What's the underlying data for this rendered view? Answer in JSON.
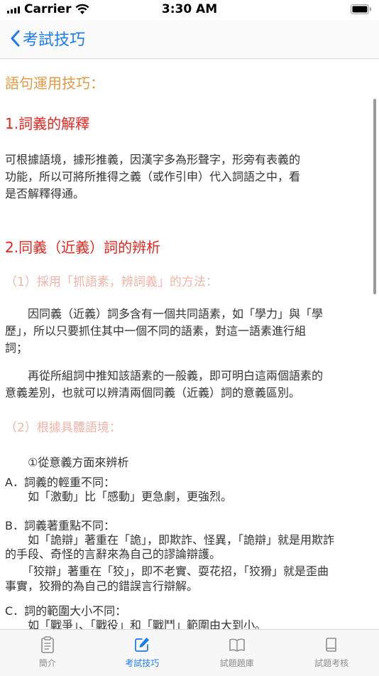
{
  "status": {
    "carrier": "Carrier",
    "time": "3:30 AM"
  },
  "nav": {
    "back_label": "考試技巧"
  },
  "article": {
    "title": "語句運用技巧：",
    "section1": {
      "heading": "1.詞義的解釋",
      "lines": [
        "可根據語境，據形推義，因漢字多為形聲字，形旁有表義的",
        "功能，所以可將所推得之義（或作引申）代入詞語之中，看",
        "是否解釋得通。"
      ]
    },
    "section2": {
      "heading": "2.同義（近義）詞的辨析",
      "sub1": "（1）採用「抓語素，辨詞義」的方法：",
      "para1": [
        "　　因同義（近義）詞多含有一個共同語素，如「學力」與「學",
        "歷」，所以只要抓住其中一個不同的語素，對這一語素進行組",
        "詞；"
      ],
      "para2": [
        "　　再從所組詞中推知該語素的一般義，即可明白這兩個語素的",
        "意義差別，也就可以辨清兩個同義（近義）詞的意義區別。"
      ],
      "sub2": "（2）根據具體語境：",
      "point": "　　①從意義方面來辨析",
      "a_title": "A．詞義的輕重不同：",
      "a_body": "　　如「激動」比「感動」更急劇，更強烈。",
      "b_title": "B．詞義著重點不同：",
      "b_body": [
        "　　如「詭辯」著重在「詭」，即欺詐、怪異，「詭辯」就是用欺詐",
        "的手段、奇怪的言辭來為自己的謬論辯護。",
        "　　「狡辯」著重在「狡」，即不老實、耍花招，「狡猾」就是歪曲",
        "事實，狡猾的為自己的錯誤言行辯解。"
      ],
      "c_title": "C．詞的範圍大小不同：",
      "c_body": "　　如「戰爭」、「戰役」和「戰鬥」範圍由大到小。"
    }
  },
  "tabs": [
    {
      "label": "簡介",
      "icon": "clipboard-icon"
    },
    {
      "label": "考試技巧",
      "icon": "pencil-square-icon"
    },
    {
      "label": "試題題庫",
      "icon": "book-open-icon"
    },
    {
      "label": "試題考核",
      "icon": "book-icon"
    }
  ],
  "colors": {
    "accent": "#1a7cf5",
    "title": "#e39a46",
    "section": "#e8241e",
    "subsection": "#f2b3a8"
  }
}
